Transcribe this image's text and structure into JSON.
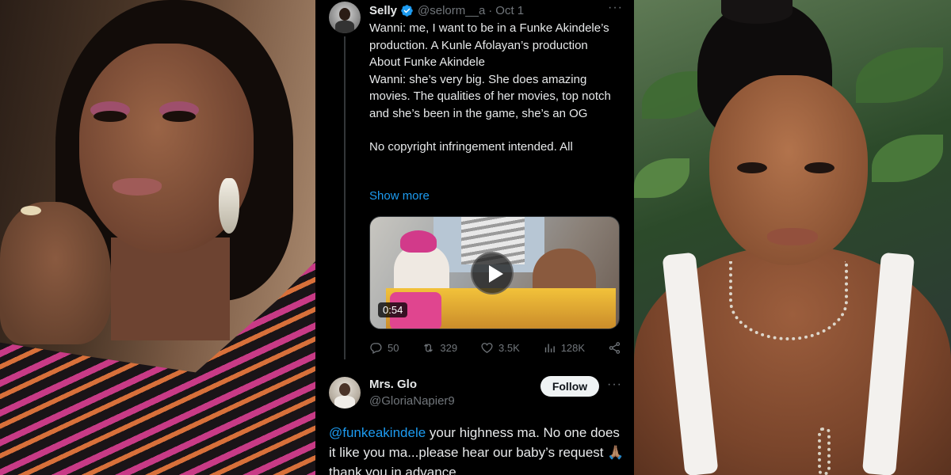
{
  "tweet1": {
    "display_name": "Selly",
    "handle": "@selorm__a",
    "separator": "·",
    "date": "Oct 1",
    "more": "···",
    "lines": [
      "Wanni: me, I want to be in a Funke Akindele’s production. A Kunle Afolayan’s production",
      "About Funke Akindele",
      "Wanni: she’s very big. She does amazing movies. The qualities of her movies, top notch and she’s been in the game, she’s an OG",
      "",
      "No copyright infringement intended. All"
    ],
    "show_more": "Show more",
    "video": {
      "duration": "0:54",
      "play_icon": "play-icon"
    },
    "stats": {
      "replies": "50",
      "reposts": "329",
      "likes": "3.5K",
      "views": "128K"
    }
  },
  "tweet2": {
    "display_name": "Mrs. Glo",
    "handle": "@GloriaNapier9",
    "follow_label": "Follow",
    "more": "···",
    "mention": "@funkeakindele",
    "text": " your highness ma. No one does it like you ma...please hear our baby’s request 🙏🏽 thank you in advance"
  },
  "colors": {
    "background": "#000000",
    "text": "#e7e9ea",
    "muted": "#71767b",
    "link": "#1d9bf0",
    "verified": "#1d9bf0"
  }
}
